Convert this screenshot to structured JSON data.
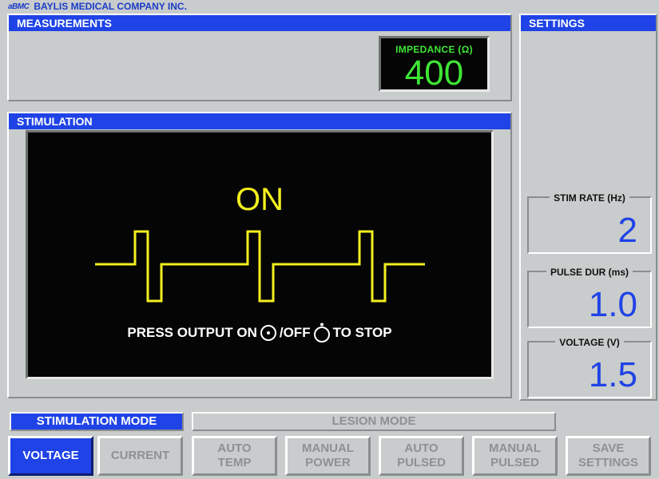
{
  "brand": {
    "logo": "aBMC",
    "company": "BAYLIS MEDICAL COMPANY INC."
  },
  "measurements": {
    "title": "MEASUREMENTS",
    "impedance_label": "IMPEDANCE (Ω)",
    "impedance_value": "400"
  },
  "stimulation": {
    "title": "STIMULATION",
    "status": "ON",
    "instruction_prefix": "PRESS OUTPUT ON",
    "instruction_mid": "/OFF",
    "instruction_suffix": "TO STOP"
  },
  "settings": {
    "title": "SETTINGS",
    "stim_rate": {
      "label": "STIM RATE (Hz)",
      "value": "2"
    },
    "pulse_dur": {
      "label": "PULSE DUR (ms)",
      "value": "1.0"
    },
    "voltage": {
      "label": "VOLTAGE (V)",
      "value": "1.5"
    }
  },
  "modes": {
    "stimulation": "STIMULATION MODE",
    "lesion": "LESION MODE"
  },
  "buttons": {
    "voltage": "VOLTAGE",
    "current": "CURRENT",
    "auto_temp": "AUTO\nTEMP",
    "manual_power": "MANUAL\nPOWER",
    "auto_pulsed": "AUTO\nPULSED",
    "manual_pulsed": "MANUAL\nPULSED",
    "save_settings": "SAVE\nSETTINGS"
  },
  "colors": {
    "accent_blue": "#1f43e6",
    "impedance_green": "#3ee634",
    "waveform_yellow": "#f3ef1f",
    "panel_gray": "#c9cccc"
  }
}
